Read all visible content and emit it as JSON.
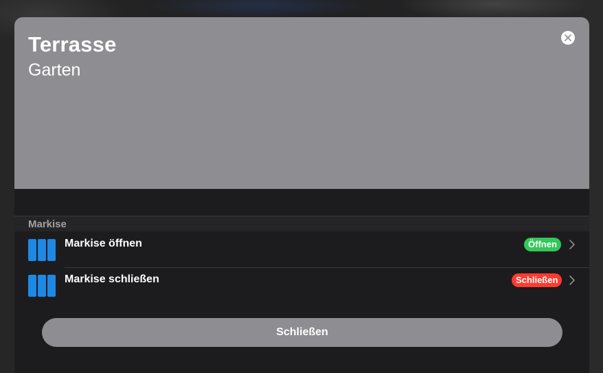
{
  "header": {
    "title": "Terrasse",
    "subtitle": "Garten",
    "close_icon": "close-icon"
  },
  "section": {
    "title": "Markise",
    "items": [
      {
        "label": "Markise öffnen",
        "badge": "Öffnen",
        "badge_color": "#34c759",
        "icon": "awning-icon",
        "icon_color": "#1e88e5"
      },
      {
        "label": "Markise schließen",
        "badge": "Schließen",
        "badge_color": "#ff3b30",
        "icon": "awning-icon",
        "icon_color": "#1e88e5"
      }
    ]
  },
  "footer": {
    "close_label": "Schließen"
  },
  "colors": {
    "header_bg": "#8e8d92",
    "panel_bg": "#1c1c1e",
    "button_bg": "#8e8d92"
  }
}
